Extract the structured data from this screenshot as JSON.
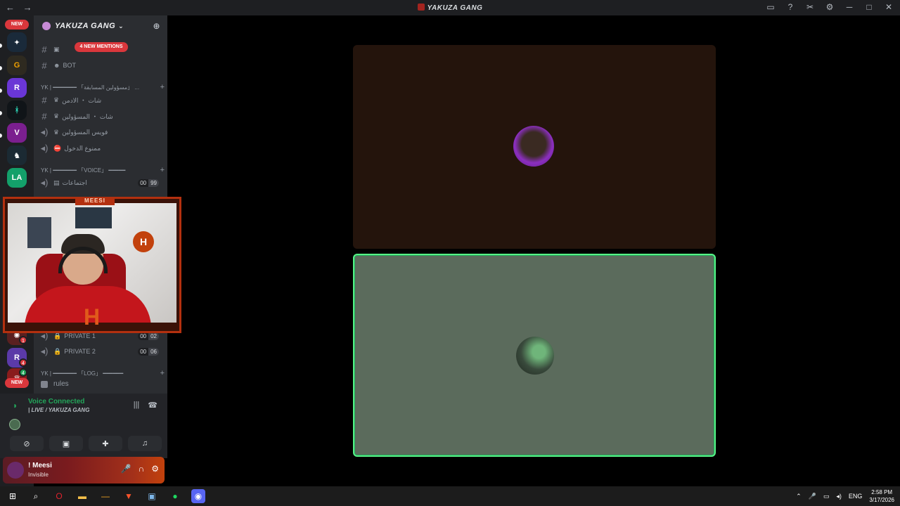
{
  "titlebar": {
    "title": "YAKUZA GANG",
    "back": "←",
    "forward": "→"
  },
  "rail": {
    "new_top": "NEW",
    "new_bottom": "NEW",
    "badges": [
      "1",
      "4",
      "4"
    ]
  },
  "sidebar": {
    "guild_name": "YAKUZA GANG",
    "new_mentions": "4 NEW MENTIONS",
    "channels": [
      {
        "label": "BOT",
        "type": "text"
      }
    ],
    "categories": [
      {
        "label": "YK | ━━━━━━━ 「مسؤولين المسابقة」 ..."
      },
      {
        "label": "YK | ━━━━━━━ 「VOICE」 ━━━━━"
      },
      {
        "label": "YK | ━━━━━━━ 「LOG」 ━━━━━━"
      }
    ],
    "admin_channels": [
      {
        "label": "شات ・ الادمن",
        "type": "text"
      },
      {
        "label": "شات ・ المسؤولين",
        "type": "text"
      },
      {
        "label": "فويس المسؤولين",
        "type": "voice"
      },
      {
        "label": "ممنوع الدخول",
        "type": "voice"
      }
    ],
    "voice_channels": [
      {
        "label": "اجتماعات",
        "a": "00",
        "b": "99"
      }
    ],
    "private_channels": [
      {
        "label": "PRIVATE 1",
        "a": "00",
        "b": "02"
      },
      {
        "label": "PRIVATE 2",
        "a": "00",
        "b": "06"
      }
    ],
    "rules": "rules"
  },
  "webcam": {
    "tag": "MEESI",
    "logo": "H"
  },
  "voice": {
    "status": "Voice Connected",
    "channel": "| LIVE / YAKUZA GANG"
  },
  "user": {
    "name": "! Meesi",
    "status": "Invisible"
  },
  "taskbar": {
    "lang": "ENG",
    "time": "2:58 PM",
    "date": "3/17/2026"
  }
}
